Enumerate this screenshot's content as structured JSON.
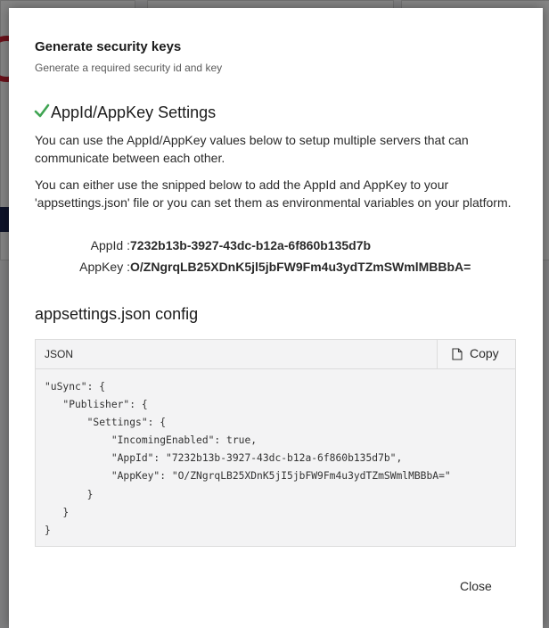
{
  "dialog": {
    "title": "Generate security keys",
    "subtitle": "Generate a required security id and key",
    "settings_heading": "AppId/AppKey Settings",
    "paragraph1": "You can use the AppId/AppKey values below to setup multiple servers that can communicate between each other.",
    "paragraph2": "You can either use the snipped below to add the AppId and AppKey to your 'appsettings.json' file or you can set them as environmental variables on your platform.",
    "appid_label": "AppId :",
    "appid_value": "7232b13b-3927-43dc-b12a-6f860b135d7b",
    "appkey_label": "AppKey :",
    "appkey_value": "O/ZNgrqLB25XDnK5jl5jbFW9Fm4u3ydTZmSWmlMBBbA=",
    "config_heading": "appsettings.json config",
    "code_language": "JSON",
    "copy_label": "Copy",
    "code": "\"uSync\": {\n   \"Publisher\": {\n       \"Settings\": {\n           \"IncomingEnabled\": true,\n           \"AppId\": \"7232b13b-3927-43dc-b12a-6f860b135d7b\",\n           \"AppKey\": \"O/ZNgrqLB25XDnK5jI5jbFW9Fm4u3ydTZmSWmlMBBbA=\"\n       }\n   }\n}",
    "close_label": "Close"
  },
  "icons": {
    "check": "check-icon",
    "copy": "copy-icon"
  },
  "colors": {
    "check_green": "#3fa452",
    "overlay": "rgba(0,0,0,0.48)"
  }
}
